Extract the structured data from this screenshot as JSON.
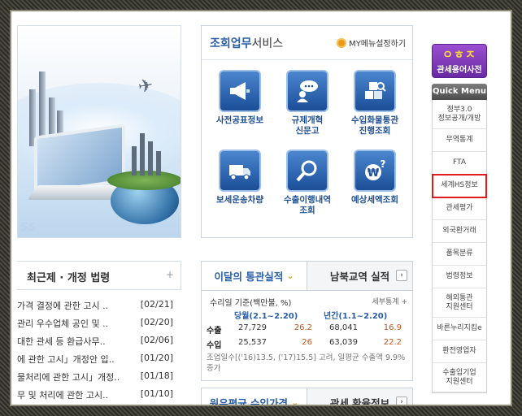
{
  "hero": {
    "caption": "SS"
  },
  "services": {
    "title_strong": "조회업무",
    "title_rest": "서비스",
    "my_menu": "MY메뉴설정하기",
    "items": [
      {
        "label": "사전공표정보",
        "icon": "megaphone-icon"
      },
      {
        "label": "규제개혁\n신문고",
        "icon": "speech-bubble-person-icon"
      },
      {
        "label": "수입화물통관\n진행조회",
        "icon": "cargo-boxes-icon"
      },
      {
        "label": "보세운송차량",
        "icon": "truck-icon"
      },
      {
        "label": "수출이행내역\n조회",
        "icon": "magnifier-icon"
      },
      {
        "label": "예상세액조회",
        "icon": "won-coin-question-icon"
      }
    ]
  },
  "dictionary": {
    "logo": "ㅇㅎㅈ",
    "label": "관세용어사전"
  },
  "quick_menu": {
    "title": "Quick Menu",
    "items": [
      {
        "label": "정부3.0\n정보공개/개방",
        "highlighted": false
      },
      {
        "label": "무역통계",
        "highlighted": false
      },
      {
        "label": "FTA",
        "highlighted": false
      },
      {
        "label": "세계HS정보",
        "highlighted": true
      },
      {
        "label": "관세평가",
        "highlighted": false
      },
      {
        "label": "외국환거래",
        "highlighted": false
      },
      {
        "label": "품목분류",
        "highlighted": false
      },
      {
        "label": "법령정보",
        "highlighted": false
      },
      {
        "label": "해외통관\n지원센터",
        "highlighted": false
      },
      {
        "label": "바른누리지킴e",
        "highlighted": false
      },
      {
        "label": "환전영업자",
        "highlighted": false
      },
      {
        "label": "수출입기업\n지원센터",
        "highlighted": false
      }
    ]
  },
  "laws": {
    "title": "최근제 · 개정 법령",
    "more": "+",
    "rows": [
      {
        "title": "가격 결정에 관한 고시 ..",
        "date": "[02/21]"
      },
      {
        "title": "관리 우수업체 공인 및 ..",
        "date": "[02/20]"
      },
      {
        "title": "대한 관세 등 환급사무..",
        "date": "[02/06]"
      },
      {
        "title": "에 관한 고시」개정안 입..",
        "date": "[01/20]"
      },
      {
        "title": "물처리에 관한 고시」개정..",
        "date": "[01/18]"
      },
      {
        "title": "무 및 처리에 관한 고시..",
        "date": "[01/10]"
      }
    ]
  },
  "monthly": {
    "tab_active": "이달의 통관실적",
    "tab_other": "남북교역 실적",
    "basis": "수리일 기준(백만불, %)",
    "more": "세부통계 +",
    "col_current": "당월(2.1~2.20)",
    "col_ytd": "년간(1.1~2.20)",
    "rows": [
      {
        "label": "수출",
        "cur_value": "27,729",
        "cur_rate": "26.2",
        "ytd_value": "68,041",
        "ytd_rate": "16.9"
      },
      {
        "label": "수입",
        "cur_value": "25,537",
        "cur_rate": "26",
        "ytd_value": "63,039",
        "ytd_rate": "22.2"
      }
    ],
    "note": "조업일수[('16)13.5, ('17)15.5] 고려, 일평균 수출액 9.9% 증가"
  },
  "price": {
    "tab_active": "원유평균 수입가격",
    "tab_other": "관세 환율정보"
  }
}
